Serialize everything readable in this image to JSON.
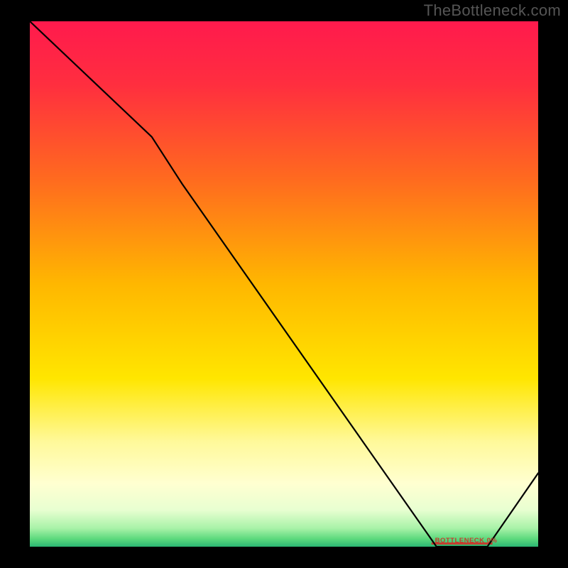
{
  "watermark": "TheBottleneck.com",
  "baseline_label": "BOTTLENECK 0%",
  "chart_data": {
    "type": "line",
    "title": "",
    "xlabel": "",
    "ylabel": "",
    "xrange": [
      0,
      100
    ],
    "yrange": [
      0,
      100
    ],
    "gradient_stops": [
      {
        "offset": 0,
        "color": "#ff1a4d"
      },
      {
        "offset": 0.12,
        "color": "#ff2e3f"
      },
      {
        "offset": 0.3,
        "color": "#ff6a1f"
      },
      {
        "offset": 0.5,
        "color": "#ffb700"
      },
      {
        "offset": 0.68,
        "color": "#ffe600"
      },
      {
        "offset": 0.8,
        "color": "#fff99a"
      },
      {
        "offset": 0.88,
        "color": "#ffffd1"
      },
      {
        "offset": 0.93,
        "color": "#e8ffd1"
      },
      {
        "offset": 0.965,
        "color": "#a8f2a8"
      },
      {
        "offset": 0.985,
        "color": "#5dd97d"
      },
      {
        "offset": 1.0,
        "color": "#2bb673"
      }
    ],
    "series": [
      {
        "name": "bottleneck-curve",
        "points": [
          {
            "x": 0,
            "y": 100
          },
          {
            "x": 24,
            "y": 78
          },
          {
            "x": 30,
            "y": 69
          },
          {
            "x": 80,
            "y": 0
          },
          {
            "x": 90,
            "y": 0
          },
          {
            "x": 100,
            "y": 14
          }
        ]
      }
    ],
    "baseline_segment": {
      "x0": 79,
      "x1": 91,
      "y": 0.6
    }
  }
}
